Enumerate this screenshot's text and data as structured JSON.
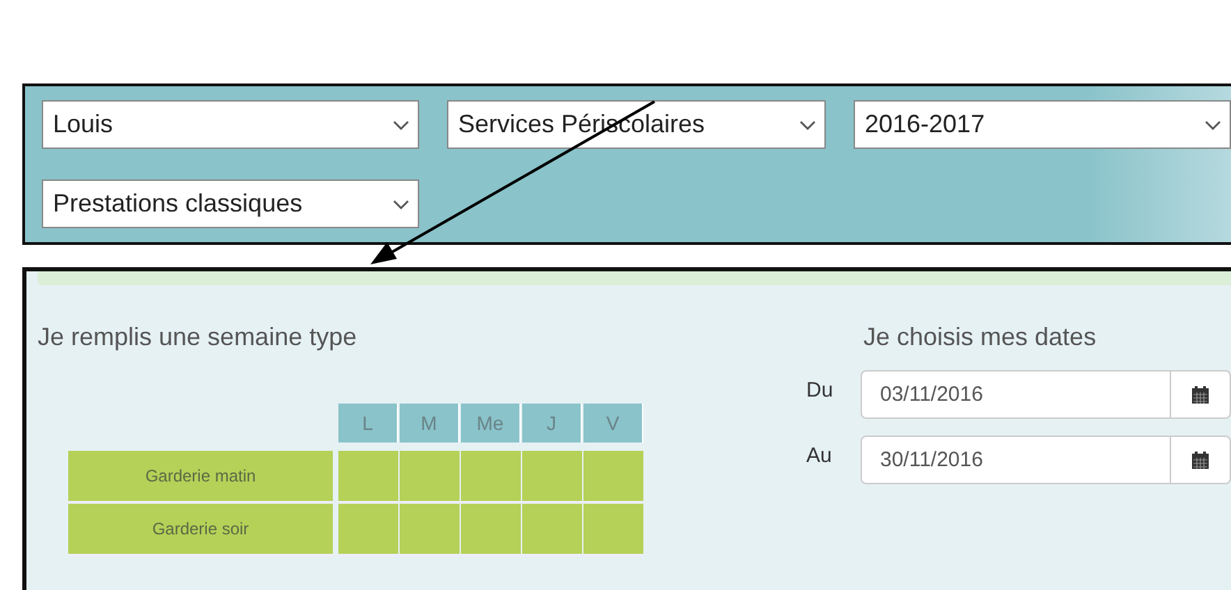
{
  "filters": [
    {
      "value": "Louis"
    },
    {
      "value": "Services Périscolaires"
    },
    {
      "value": "2016-2017"
    },
    {
      "value": "Prestations classiques"
    }
  ],
  "week_template": {
    "title": "Je remplis une semaine type",
    "days": [
      "L",
      "M",
      "Me",
      "J",
      "V"
    ],
    "rows": [
      {
        "label": "Garderie matin"
      },
      {
        "label": "Garderie soir"
      }
    ]
  },
  "dates": {
    "title": "Je choisis mes dates",
    "fields": [
      {
        "label": "Du",
        "value": "03/11/2016"
      },
      {
        "label": "Au",
        "value": "30/11/2016"
      }
    ]
  }
}
